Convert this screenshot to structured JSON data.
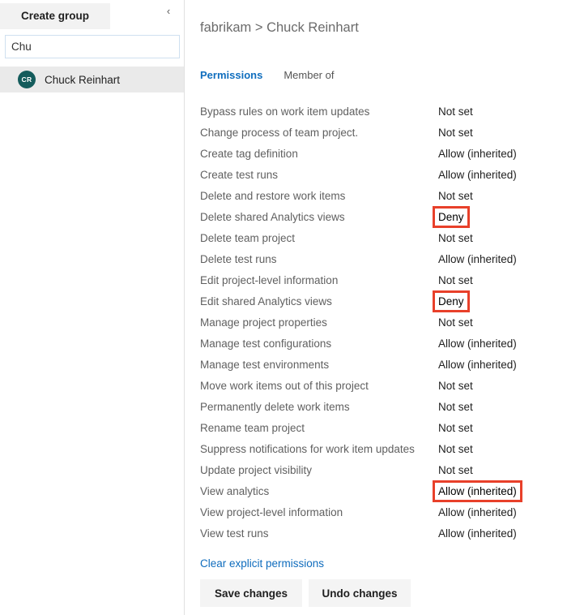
{
  "sidebar": {
    "create_group_label": "Create group",
    "collapse_icon": "chevron-left-icon",
    "collapse_glyph": "‹",
    "search": {
      "value": "Chu",
      "placeholder": "Search users or groups"
    },
    "people": [
      {
        "initials": "CR",
        "name": "Chuck Reinhart",
        "avatar_color": "#145c5c",
        "selected": true
      }
    ]
  },
  "main": {
    "breadcrumb": "fabrikam > Chuck Reinhart",
    "breadcrumb_parts": {
      "org": "fabrikam",
      "separator": ">",
      "identity": "Chuck Reinhart"
    },
    "tabs": [
      {
        "label": "Permissions",
        "active": true
      },
      {
        "label": "Member of",
        "active": false
      }
    ],
    "permissions": [
      {
        "label": "Bypass rules on work item updates",
        "value": "Not set",
        "highlighted": false
      },
      {
        "label": "Change process of team project.",
        "value": "Not set",
        "highlighted": false
      },
      {
        "label": "Create tag definition",
        "value": "Allow (inherited)",
        "highlighted": false
      },
      {
        "label": "Create test runs",
        "value": "Allow (inherited)",
        "highlighted": false
      },
      {
        "label": "Delete and restore work items",
        "value": "Not set",
        "highlighted": false
      },
      {
        "label": "Delete shared Analytics views",
        "value": "Deny",
        "highlighted": true
      },
      {
        "label": "Delete team project",
        "value": "Not set",
        "highlighted": false
      },
      {
        "label": "Delete test runs",
        "value": "Allow (inherited)",
        "highlighted": false
      },
      {
        "label": "Edit project-level information",
        "value": "Not set",
        "highlighted": false
      },
      {
        "label": "Edit shared Analytics views",
        "value": "Deny",
        "highlighted": true
      },
      {
        "label": "Manage project properties",
        "value": "Not set",
        "highlighted": false
      },
      {
        "label": "Manage test configurations",
        "value": "Allow (inherited)",
        "highlighted": false
      },
      {
        "label": "Manage test environments",
        "value": "Allow (inherited)",
        "highlighted": false
      },
      {
        "label": "Move work items out of this project",
        "value": "Not set",
        "highlighted": false
      },
      {
        "label": "Permanently delete work items",
        "value": "Not set",
        "highlighted": false
      },
      {
        "label": "Rename team project",
        "value": "Not set",
        "highlighted": false
      },
      {
        "label": "Suppress notifications for work item updates",
        "value": "Not set",
        "highlighted": false
      },
      {
        "label": "Update project visibility",
        "value": "Not set",
        "highlighted": false
      },
      {
        "label": "View analytics",
        "value": "Allow (inherited)",
        "highlighted": true
      },
      {
        "label": "View project-level information",
        "value": "Allow (inherited)",
        "highlighted": false
      },
      {
        "label": "View test runs",
        "value": "Allow (inherited)",
        "highlighted": false
      }
    ],
    "clear_link_label": "Clear explicit permissions",
    "buttons": [
      {
        "label": "Save changes"
      },
      {
        "label": "Undo changes"
      }
    ]
  },
  "colors": {
    "accent_link": "#0f6cbd",
    "tab_active": "#106ebe",
    "highlight_outline": "#e8402a",
    "avatar": "#145c5c",
    "button_bg": "#f4f4f4",
    "selected_row_bg": "#eaeaea"
  }
}
